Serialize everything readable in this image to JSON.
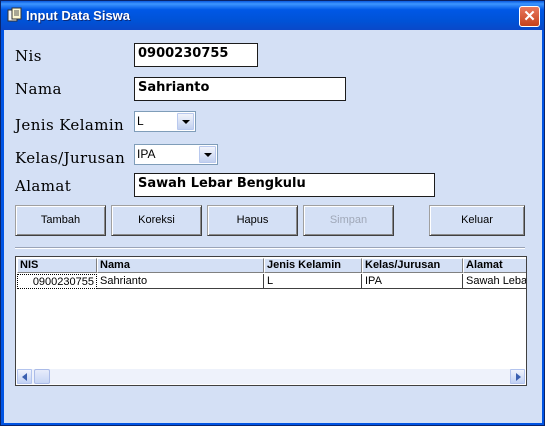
{
  "window": {
    "title": "Input Data Siswa"
  },
  "form": {
    "nis": {
      "label": "Nis",
      "value": "0900230755"
    },
    "nama": {
      "label": "Nama",
      "value": "Sahrianto"
    },
    "jenis_kelamin": {
      "label": "Jenis Kelamin",
      "value": "L"
    },
    "kelas_jurusan": {
      "label": "Kelas/Jurusan",
      "value": "IPA"
    },
    "alamat": {
      "label": "Alamat",
      "value": "Sawah Lebar Bengkulu"
    }
  },
  "buttons": {
    "tambah": "Tambah",
    "koreksi": "Koreksi",
    "hapus": "Hapus",
    "simpan": "Simpan",
    "keluar": "Keluar"
  },
  "grid": {
    "columns": [
      "NIS",
      "Nama",
      "Jenis Kelamin",
      "Kelas/Jurusan",
      "Alamat"
    ],
    "rows": [
      [
        "0900230755",
        "Sahrianto",
        "L",
        "IPA",
        "Sawah Lebar Bengkulu"
      ]
    ]
  },
  "colors": {
    "titlebar": "#0054e3",
    "client_bg": "#d4e0f5",
    "close_button": "#d9542f"
  }
}
